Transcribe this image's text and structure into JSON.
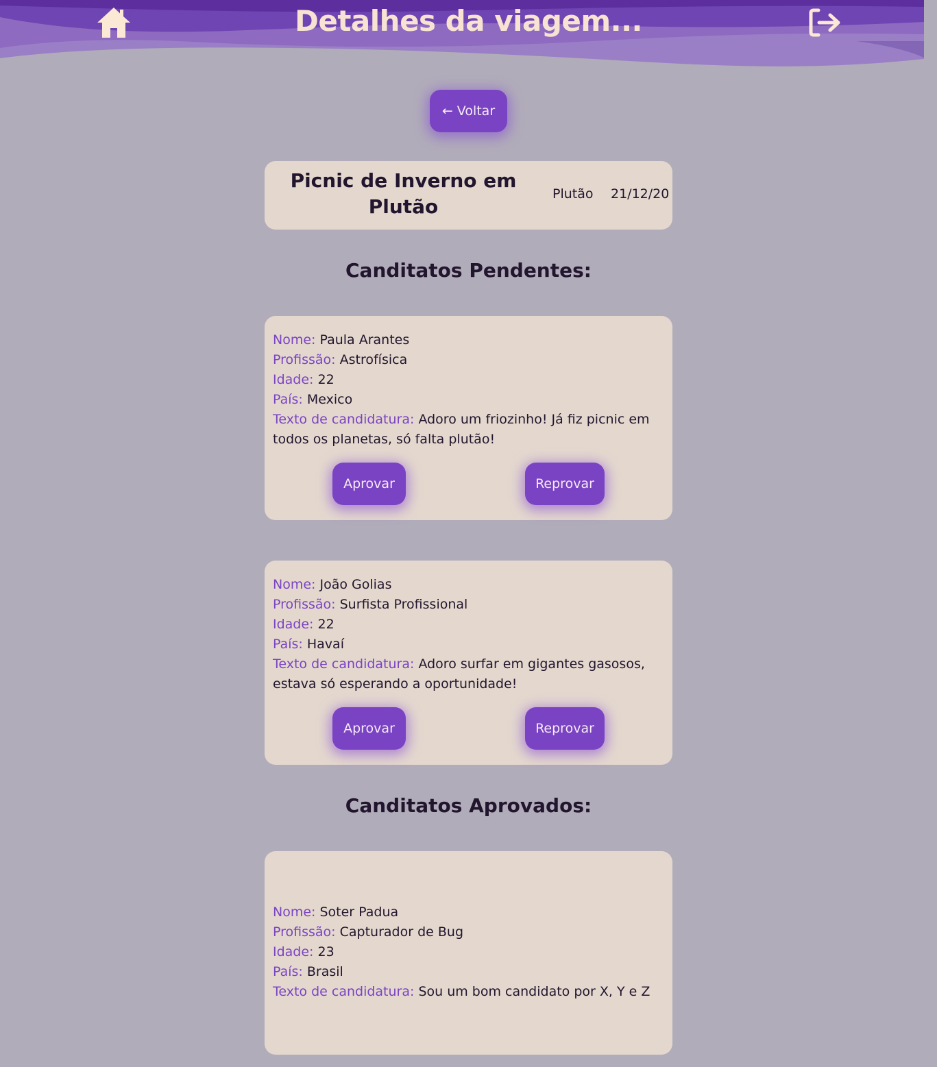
{
  "header": {
    "title": "Detalhes da viagem...",
    "home_icon": "home-icon",
    "logout_icon": "logout-icon"
  },
  "back_label": "← Voltar",
  "trip": {
    "name": "Picnic de Inverno em Plutão",
    "planet": "Plutão",
    "date": "21/12/20"
  },
  "labels": {
    "name": "Nome:",
    "profession": "Profissão:",
    "age": "Idade:",
    "country": "País:",
    "application_text": "Texto de candidatura:",
    "approve": "Aprovar",
    "reject": "Reprovar"
  },
  "pending": {
    "title": "Canditatos Pendentes:",
    "candidates": [
      {
        "name": "Paula Arantes",
        "profession": "Astrofísica",
        "age": "22",
        "country": "Mexico",
        "application_text": "Adoro um friozinho! Já fiz picnic em todos os planetas, só falta plutão!"
      },
      {
        "name": "João Golias",
        "profession": "Surfista Profissional",
        "age": "22",
        "country": "Havaí",
        "application_text": "Adoro surfar em gigantes gasosos, estava só esperando a oportunidade!"
      }
    ]
  },
  "approved": {
    "title": "Canditatos Aprovados:",
    "candidates": [
      {
        "name": "Soter Padua",
        "profession": "Capturador de Bug",
        "age": "23",
        "country": "Brasil",
        "application_text": "Sou um bom candidato por X, Y e Z"
      }
    ]
  },
  "colors": {
    "header": "#6232a8",
    "accent": "#7a43c3",
    "background": "#b1acba",
    "card": "#e4d8ce",
    "header_text": "#f8e3d3"
  }
}
